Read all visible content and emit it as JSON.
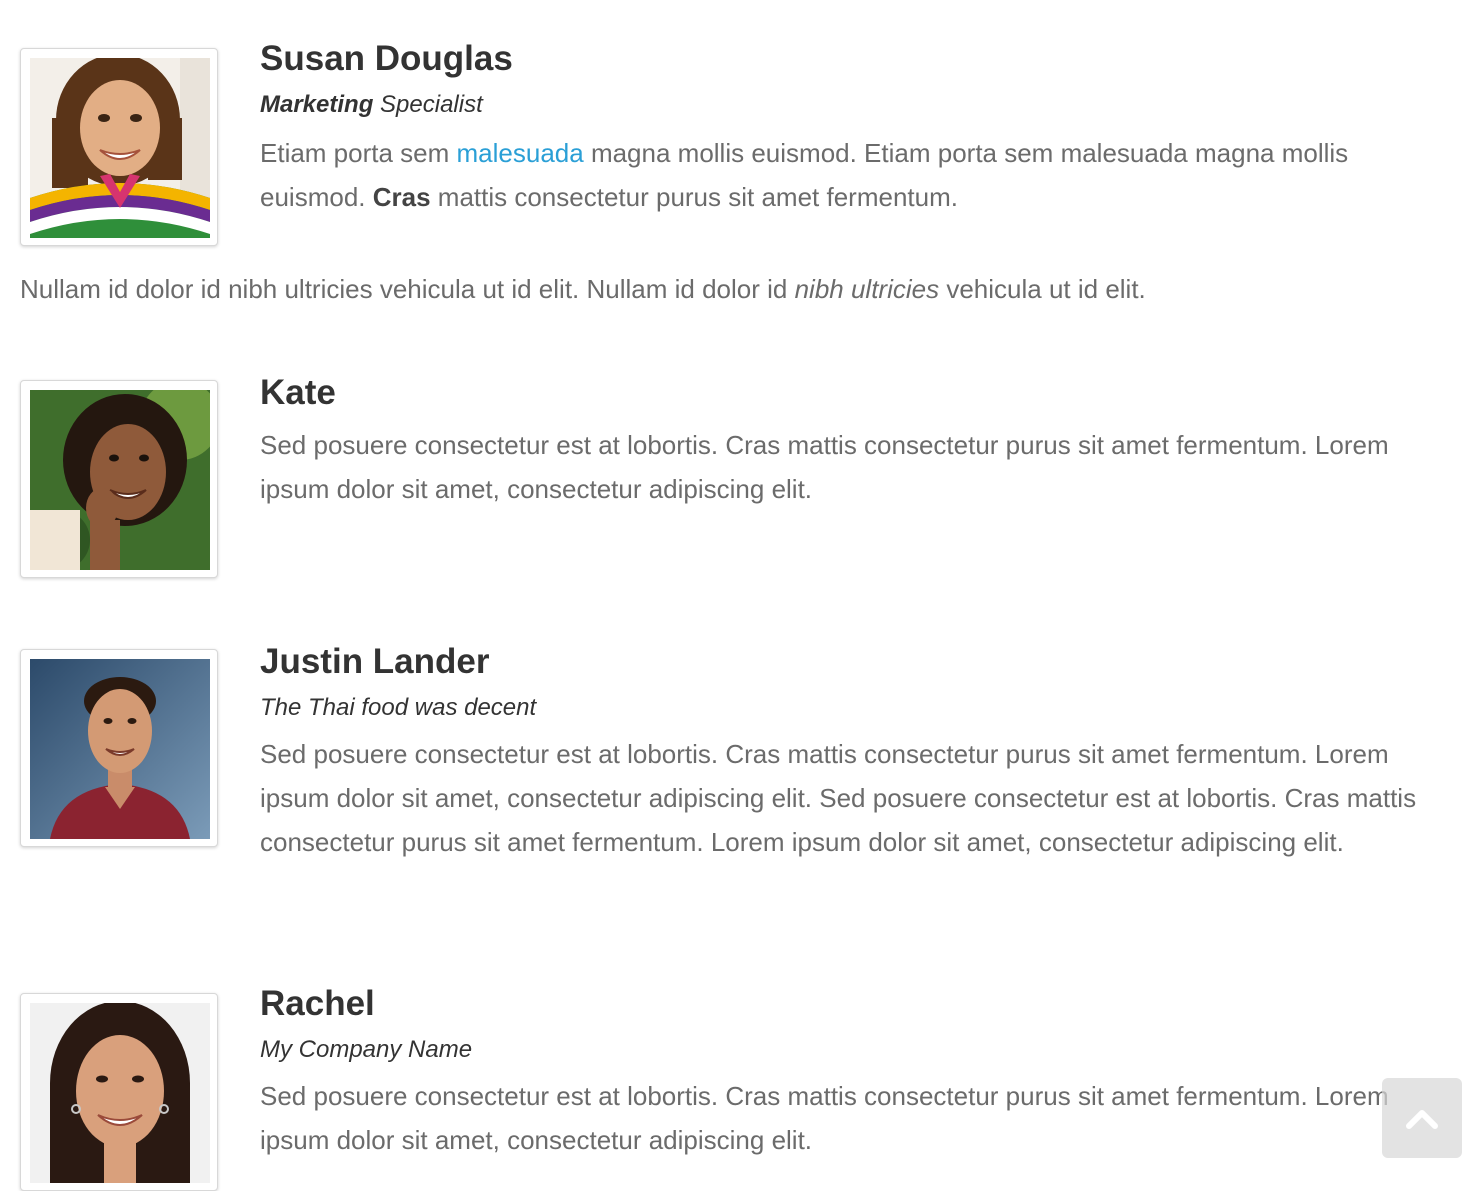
{
  "team": [
    {
      "name": "Susan Douglas",
      "role_bold": "Marketing",
      "role_rest": " Specialist",
      "bio_1": "Etiam porta sem ",
      "bio_link": "malesuada",
      "bio_2": " magna mollis euismod. Etiam porta sem malesuada magna mollis euismod. ",
      "bio_bold": "Cras",
      "bio_3": " mattis consectetur purus sit amet fermentum.",
      "photo_icon": "portrait-girl-striped-sweater"
    },
    {
      "name": "Kate",
      "bio": "Sed posuere consectetur est at lobortis. Cras mattis consectetur purus sit amet fermentum. Lorem ipsum dolor sit amet, consectetur adipiscing elit.",
      "photo_icon": "portrait-smiling-woman-outdoors"
    },
    {
      "name": "Justin Lander",
      "role": "The Thai food was decent",
      "bio": "Sed posuere consectetur est at lobortis. Cras mattis consectetur purus sit amet fermentum. Lorem ipsum dolor sit amet, consectetur adipiscing elit. Sed posuere consectetur est at lobortis. Cras mattis consectetur purus sit amet fermentum. Lorem ipsum dolor sit amet, consectetur adipiscing elit.",
      "photo_icon": "portrait-young-man-red-shirt"
    },
    {
      "name": "Rachel",
      "role": "My Company Name",
      "bio": "Sed posuere consectetur est at lobortis. Cras mattis consectetur purus sit amet fermentum. Lorem ipsum dolor sit amet, consectetur adipiscing elit.",
      "photo_icon": "portrait-smiling-woman"
    }
  ],
  "note": {
    "text_1": "Nullam id dolor id nibh ultricies vehicula ut id elit. Nullam id dolor id ",
    "emphasis": "nibh ultricies",
    "text_2": " vehicula ut id elit."
  },
  "back_to_top": {
    "icon": "chevron-up-icon"
  },
  "colors": {
    "heading": "#333333",
    "body_text": "#6b6b6b",
    "link": "#2a9fd6",
    "frame_border": "#d8d8d8",
    "back_to_top_bg": "#d7d7d7"
  }
}
